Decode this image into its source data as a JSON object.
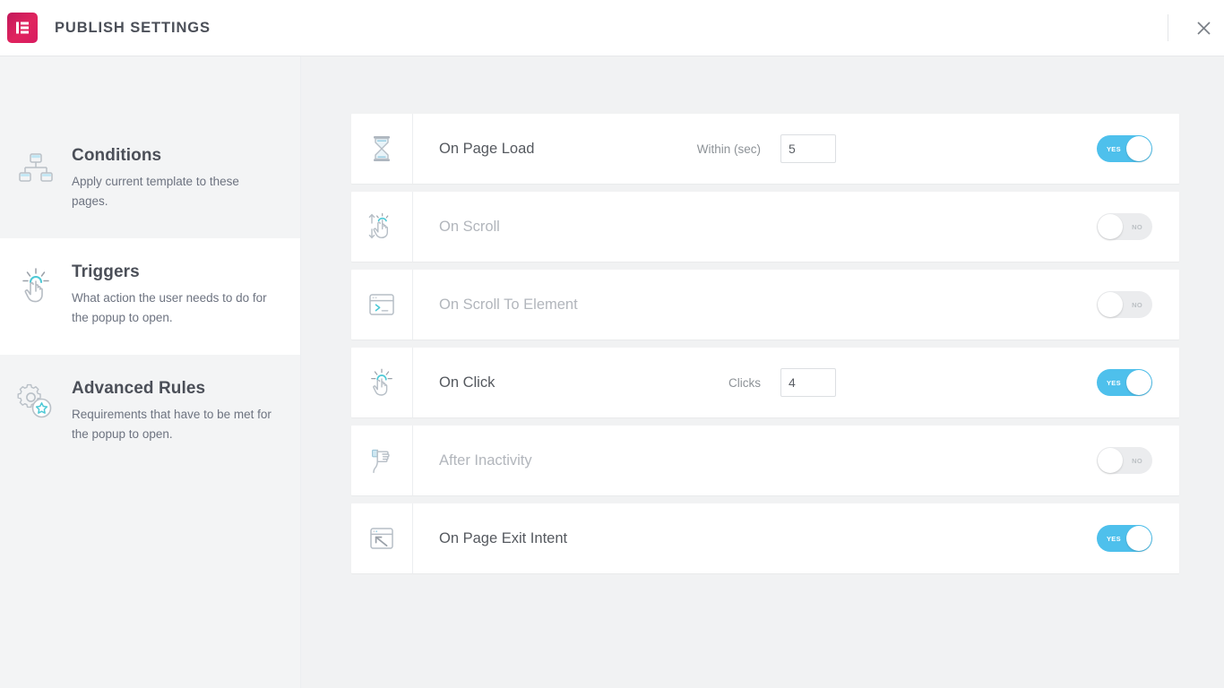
{
  "header": {
    "title": "PUBLISH SETTINGS",
    "logo_icon": "elementor-logo-icon",
    "logo_color": "#d81b60",
    "close_icon": "close-icon"
  },
  "sidebar": {
    "items": [
      {
        "id": "conditions",
        "icon": "sitemap-icon",
        "title": "Conditions",
        "description": "Apply current template to these pages.",
        "active": false
      },
      {
        "id": "triggers",
        "icon": "tap-hand-icon",
        "title": "Triggers",
        "description": "What action the user needs to do for the popup to open.",
        "active": true
      },
      {
        "id": "advanced-rules",
        "icon": "gear-star-icon",
        "title": "Advanced Rules",
        "description": "Requirements that have to be met for the popup to open.",
        "active": false
      }
    ]
  },
  "main": {
    "accent_on_color": "#4ec0ec",
    "toggle_off_color": "#ebecee",
    "toggle_on_label": "YES",
    "toggle_off_label": "NO",
    "triggers": [
      {
        "id": "on-page-load",
        "icon": "hourglass-icon",
        "label": "On Page Load",
        "enabled": true,
        "control": {
          "label": "Within (sec)",
          "value": "5"
        }
      },
      {
        "id": "on-scroll",
        "icon": "scroll-hand-icon",
        "label": "On Scroll",
        "enabled": false,
        "control": null
      },
      {
        "id": "on-scroll-to-element",
        "icon": "browser-code-icon",
        "label": "On Scroll To Element",
        "enabled": false,
        "control": null
      },
      {
        "id": "on-click",
        "icon": "click-hand-icon",
        "label": "On Click",
        "enabled": true,
        "control": {
          "label": "Clicks",
          "value": "4"
        }
      },
      {
        "id": "after-inactivity",
        "icon": "idle-hand-icon",
        "label": "After Inactivity",
        "enabled": false,
        "control": null
      },
      {
        "id": "on-page-exit-intent",
        "icon": "browser-exit-arrow-icon",
        "label": "On Page Exit Intent",
        "enabled": true,
        "control": null
      }
    ]
  }
}
